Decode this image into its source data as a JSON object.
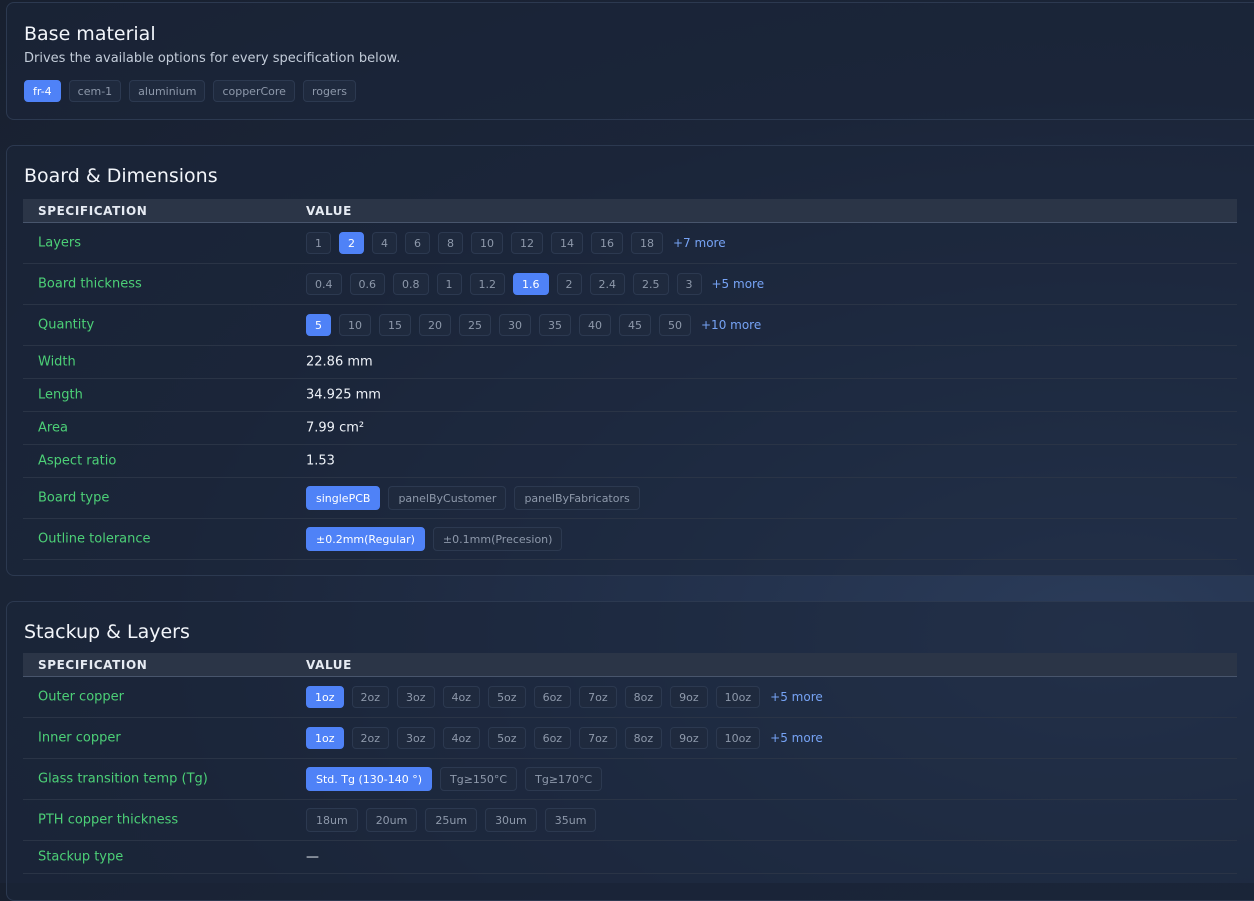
{
  "base_material": {
    "title": "Base material",
    "subtitle": "Drives the available options for every specification below.",
    "options": [
      {
        "label": "fr-4",
        "active": true
      },
      {
        "label": "cem-1",
        "active": false
      },
      {
        "label": "aluminium",
        "active": false
      },
      {
        "label": "copperCore",
        "active": false
      },
      {
        "label": "rogers",
        "active": false
      }
    ]
  },
  "board": {
    "title": "Board & Dimensions",
    "headers": {
      "spec": "SPECIFICATION",
      "value": "VALUE"
    },
    "rows": [
      {
        "label": "Layers",
        "type": "chips",
        "options": [
          "1",
          "2",
          "4",
          "6",
          "8",
          "10",
          "12",
          "14",
          "16",
          "18"
        ],
        "selected": "2",
        "more": "+7 more"
      },
      {
        "label": "Board thickness",
        "type": "chips",
        "options": [
          "0.4",
          "0.6",
          "0.8",
          "1",
          "1.2",
          "1.6",
          "2",
          "2.4",
          "2.5",
          "3"
        ],
        "selected": "1.6",
        "more": "+5 more"
      },
      {
        "label": "Quantity",
        "type": "chips",
        "options": [
          "5",
          "10",
          "15",
          "20",
          "25",
          "30",
          "35",
          "40",
          "45",
          "50"
        ],
        "selected": "5",
        "more": "+10 more"
      },
      {
        "label": "Width",
        "type": "text",
        "value": "22.86 mm"
      },
      {
        "label": "Length",
        "type": "text",
        "value": "34.925 mm"
      },
      {
        "label": "Area",
        "type": "text",
        "value": "7.99 cm²"
      },
      {
        "label": "Aspect ratio",
        "type": "text",
        "value": "1.53"
      },
      {
        "label": "Board type",
        "type": "chips",
        "big": true,
        "options": [
          "singlePCB",
          "panelByCustomer",
          "panelByFabricators"
        ],
        "selected": "singlePCB"
      },
      {
        "label": "Outline tolerance",
        "type": "chips",
        "big": true,
        "options": [
          "±0.2mm(Regular)",
          "±0.1mm(Precesion)"
        ],
        "selected": "±0.2mm(Regular)"
      }
    ]
  },
  "stackup": {
    "title": "Stackup & Layers",
    "headers": {
      "spec": "SPECIFICATION",
      "value": "VALUE"
    },
    "rows": [
      {
        "label": "Outer copper",
        "type": "chips",
        "options": [
          "1oz",
          "2oz",
          "3oz",
          "4oz",
          "5oz",
          "6oz",
          "7oz",
          "8oz",
          "9oz",
          "10oz"
        ],
        "selected": "1oz",
        "more": "+5 more"
      },
      {
        "label": "Inner copper",
        "type": "chips",
        "options": [
          "1oz",
          "2oz",
          "3oz",
          "4oz",
          "5oz",
          "6oz",
          "7oz",
          "8oz",
          "9oz",
          "10oz"
        ],
        "selected": "1oz",
        "more": "+5 more"
      },
      {
        "label": "Glass transition temp (Tg)",
        "type": "chips",
        "big": true,
        "options": [
          "Std. Tg (130-140 °)",
          "Tg≥150°C",
          "Tg≥170°C"
        ],
        "selected": "Std. Tg (130-140 °)"
      },
      {
        "label": "PTH copper thickness",
        "type": "chips",
        "big": true,
        "options": [
          "18um",
          "20um",
          "25um",
          "30um",
          "35um"
        ],
        "selected": ""
      },
      {
        "label": "Stackup type",
        "type": "text",
        "value": "—"
      }
    ]
  }
}
